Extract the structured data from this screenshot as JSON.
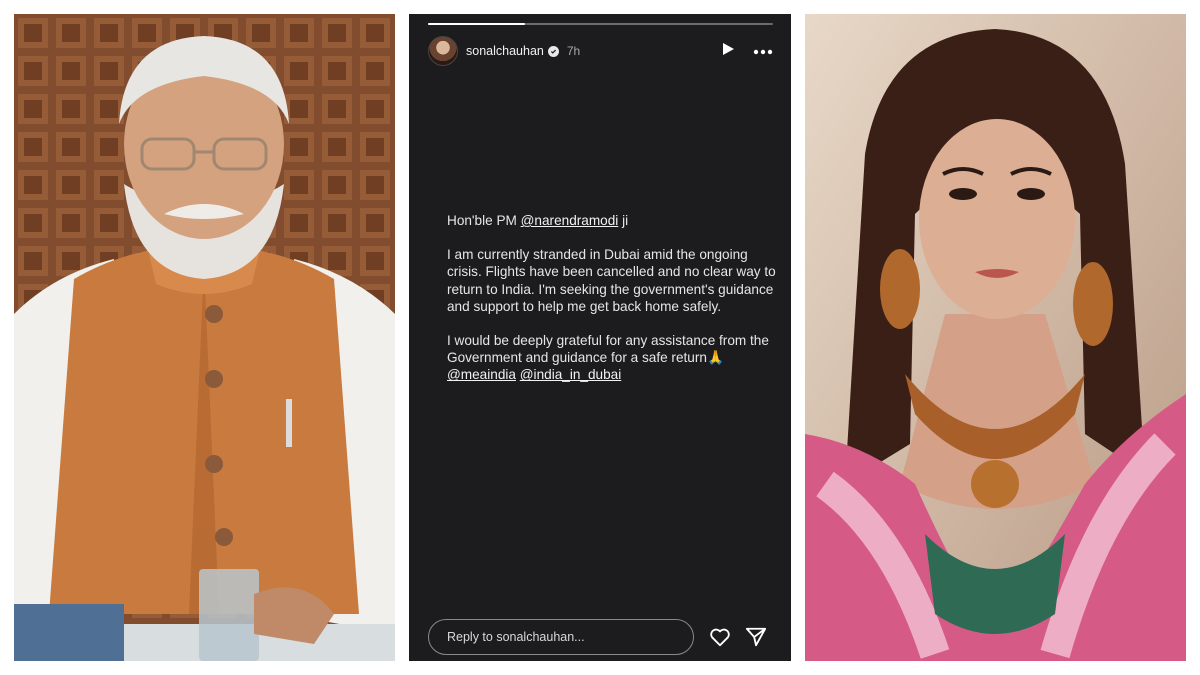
{
  "story": {
    "username": "sonalchauhan",
    "time": "7h",
    "progress": 0.28,
    "message": {
      "salutation_prefix": "Hon'ble PM ",
      "salutation_mention": "@narendramodi",
      "salutation_suffix": " ji",
      "paragraph1": "I am currently stranded in Dubai amid the ongoing crisis. Flights have been cancelled and no clear way  to return to India. I'm seeking the government's guidance and support to help me get back home safely.",
      "paragraph2": "I would be deeply grateful for any assistance from the Government and guidance for a safe return🙏",
      "mention1": "@meaindia",
      "mention2": "@india_in_dubai"
    },
    "reply_placeholder": "Reply to sonalchauhan..."
  },
  "icons": {
    "verified": "verified-badge-icon",
    "play": "play-icon",
    "more": "more-options-icon",
    "like": "heart-icon",
    "share": "send-icon"
  },
  "colors": {
    "story_background": "#1c1c1e",
    "text": "#e6e6e6",
    "vest": "#c97a3e",
    "saree_pink": "#d65a86"
  }
}
